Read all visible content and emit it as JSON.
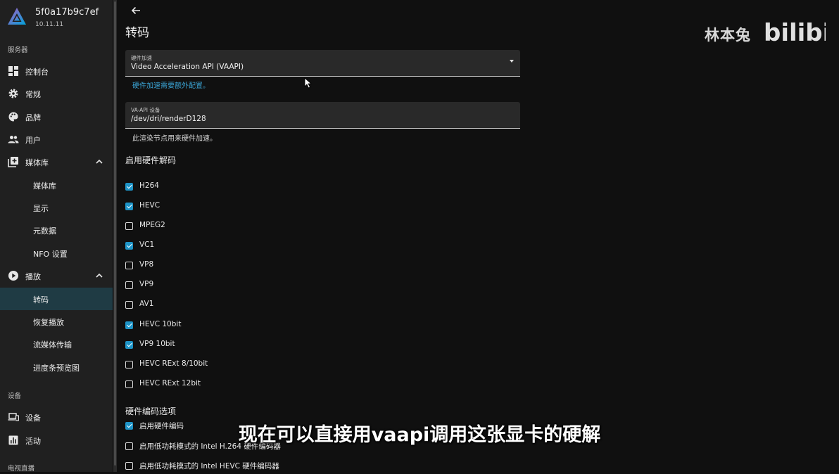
{
  "server": {
    "name": "5f0a17b9c7ef",
    "version": "10.11.11"
  },
  "sidebar": {
    "section_server": "服务器",
    "items": [
      {
        "label": "控制台",
        "icon": "dashboard-icon"
      },
      {
        "label": "常规",
        "icon": "gear-icon"
      },
      {
        "label": "品牌",
        "icon": "palette-icon"
      },
      {
        "label": "用户",
        "icon": "users-icon"
      },
      {
        "label": "媒体库",
        "icon": "library-add-icon"
      }
    ],
    "library_sub": [
      "媒体库",
      "显示",
      "元数据",
      "NFO 设置"
    ],
    "playback": {
      "label": "播放",
      "icon": "play-circle-icon"
    },
    "playback_sub": [
      "转码",
      "恢复播放",
      "流媒体传输",
      "进度条预览图"
    ],
    "active_item": "转码",
    "section_devices": "设备",
    "devices_items": [
      {
        "label": "设备",
        "icon": "devices-icon"
      },
      {
        "label": "活动",
        "icon": "activity-chart-icon"
      }
    ],
    "section_livetv": "电视直播"
  },
  "page": {
    "title": "转码",
    "hw_accel": {
      "label": "硬件加速",
      "value": "Video Acceleration API (VAAPI)",
      "help_link": "硬件加速需要额外配置。"
    },
    "vaapi_device": {
      "label": "VA-API 设备",
      "value": "/dev/dri/renderD128",
      "help": "此渲染节点用来硬件加速。"
    },
    "decoding": {
      "title": "启用硬件解码",
      "codecs": [
        {
          "label": "H264",
          "checked": true
        },
        {
          "label": "HEVC",
          "checked": true
        },
        {
          "label": "MPEG2",
          "checked": false
        },
        {
          "label": "VC1",
          "checked": true
        },
        {
          "label": "VP8",
          "checked": false
        },
        {
          "label": "VP9",
          "checked": false
        },
        {
          "label": "AV1",
          "checked": false
        },
        {
          "label": "HEVC 10bit",
          "checked": true
        },
        {
          "label": "VP9 10bit",
          "checked": true
        },
        {
          "label": "HEVC RExt 8/10bit",
          "checked": false
        },
        {
          "label": "HEVC RExt 12bit",
          "checked": false
        }
      ]
    },
    "encoding": {
      "title": "硬件编码选项",
      "options": [
        {
          "label": "启用硬件编码",
          "checked": true
        },
        {
          "label": "启用低功耗模式的 Intel H.264 硬件编码器",
          "checked": false
        },
        {
          "label": "启用低功耗模式的 Intel HEVC 硬件编码器",
          "checked": false
        }
      ]
    }
  },
  "overlay": {
    "watermark_text": "林本兔",
    "watermark_logo": "bilibili",
    "subtitle": "现在可以直接用vaapi调用这张显卡的硬解"
  },
  "colors": {
    "accent": "#1e94c7",
    "active_bg": "#1f3b44",
    "sidebar_bg": "#202020",
    "page_bg": "#101010"
  }
}
